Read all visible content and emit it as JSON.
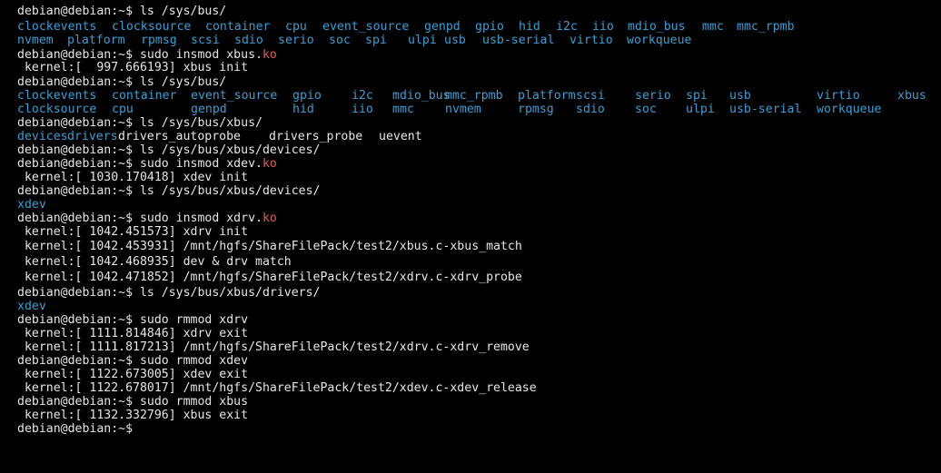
{
  "colors": {
    "background": "#000000",
    "text": "#e6e6e6",
    "directory": "#3a9fd6",
    "ko_ext": "#e05a5a"
  },
  "lines": [
    {
      "segs": [
        {
          "text": "debian@debian:~$ ls /sys/bus/",
          "c": "normal"
        }
      ]
    },
    {
      "segs": [
        {
          "text": "clockevents",
          "c": "blue"
        },
        {
          "text": "clocksource",
          "c": "blue"
        },
        {
          "text": "container",
          "c": "blue"
        },
        {
          "text": "cpu",
          "c": "blue"
        },
        {
          "text": "event_source",
          "c": "blue"
        },
        {
          "text": "genpd",
          "c": "blue"
        },
        {
          "text": "gpio",
          "c": "blue"
        },
        {
          "text": "hid",
          "c": "blue"
        },
        {
          "text": "i2c",
          "c": "blue"
        },
        {
          "text": "iio",
          "c": "blue"
        },
        {
          "text": "mdio_bus",
          "c": "blue"
        },
        {
          "text": "mmc",
          "c": "blue"
        },
        {
          "text": "mmc_rpmb",
          "c": "blue"
        }
      ]
    },
    {
      "segs": [
        {
          "text": "nvmem",
          "c": "blue"
        },
        {
          "text": "platform",
          "c": "blue"
        },
        {
          "text": "rpmsg",
          "c": "blue"
        },
        {
          "text": "scsi",
          "c": "blue"
        },
        {
          "text": "sdio",
          "c": "blue"
        },
        {
          "text": "serio",
          "c": "blue"
        },
        {
          "text": "soc",
          "c": "blue"
        },
        {
          "text": "spi",
          "c": "blue"
        },
        {
          "text": "ulpi",
          "c": "blue"
        },
        {
          "text": "usb",
          "c": "blue"
        },
        {
          "text": "usb-serial",
          "c": "blue"
        },
        {
          "text": "virtio",
          "c": "blue"
        },
        {
          "text": "workqueue",
          "c": "blue"
        }
      ]
    },
    {
      "segs": [
        {
          "text": "debian@debian:~$ sudo insmod xbus.",
          "c": "normal"
        },
        {
          "text": "ko",
          "c": "red"
        }
      ]
    },
    {
      "segs": [
        {
          "text": " kernel:[  997.666193] xbus init",
          "c": "normal"
        }
      ]
    },
    {
      "segs": [
        {
          "text": "debian@debian:~$ ls /sys/bus/",
          "c": "normal"
        }
      ]
    },
    {
      "segs": [
        {
          "text": "clockevents",
          "c": "blue"
        },
        {
          "text": "container",
          "c": "blue"
        },
        {
          "text": "event_source",
          "c": "blue"
        },
        {
          "text": "gpio",
          "c": "blue"
        },
        {
          "text": "i2c",
          "c": "blue"
        },
        {
          "text": "mdio_bus",
          "c": "blue"
        },
        {
          "text": "mmc_rpmb",
          "c": "blue"
        },
        {
          "text": "platform",
          "c": "blue"
        },
        {
          "text": "scsi",
          "c": "blue"
        },
        {
          "text": "serio",
          "c": "blue"
        },
        {
          "text": "spi",
          "c": "blue"
        },
        {
          "text": "usb",
          "c": "blue"
        },
        {
          "text": "virtio",
          "c": "blue"
        },
        {
          "text": "xbus",
          "c": "blue"
        }
      ]
    },
    {
      "segs": [
        {
          "text": "clocksource",
          "c": "blue"
        },
        {
          "text": "cpu",
          "c": "blue"
        },
        {
          "text": "genpd",
          "c": "blue"
        },
        {
          "text": "hid",
          "c": "blue"
        },
        {
          "text": "iio",
          "c": "blue"
        },
        {
          "text": "mmc",
          "c": "blue"
        },
        {
          "text": "nvmem",
          "c": "blue"
        },
        {
          "text": "rpmsg",
          "c": "blue"
        },
        {
          "text": "sdio",
          "c": "blue"
        },
        {
          "text": "soc",
          "c": "blue"
        },
        {
          "text": "ulpi",
          "c": "blue"
        },
        {
          "text": "usb-serial",
          "c": "blue"
        },
        {
          "text": "workqueue",
          "c": "blue"
        }
      ]
    },
    {
      "segs": [
        {
          "text": "debian@debian:~$ ls /sys/bus/xbus/",
          "c": "normal"
        }
      ]
    },
    {
      "segs": [
        {
          "text": "devices",
          "c": "blue"
        },
        {
          "text": "drivers",
          "c": "blue"
        },
        {
          "text": "drivers_autoprobe",
          "c": "normal"
        },
        {
          "text": "drivers_probe",
          "c": "normal"
        },
        {
          "text": "uevent",
          "c": "normal"
        }
      ]
    },
    {
      "segs": [
        {
          "text": "debian@debian:~$ ls /sys/bus/xbus/devices/",
          "c": "normal"
        }
      ]
    },
    {
      "segs": [
        {
          "text": "debian@debian:~$ sudo insmod xdev.",
          "c": "normal"
        },
        {
          "text": "ko",
          "c": "red"
        }
      ]
    },
    {
      "segs": [
        {
          "text": " kernel:[ 1030.170418] xdev init",
          "c": "normal"
        }
      ]
    },
    {
      "segs": [
        {
          "text": "debian@debian:~$ ls /sys/bus/xbus/devices/",
          "c": "normal"
        }
      ]
    },
    {
      "segs": [
        {
          "text": "xdev",
          "c": "blue"
        }
      ]
    },
    {
      "segs": [
        {
          "text": "debian@debian:~$ sudo insmod xdrv.",
          "c": "normal"
        },
        {
          "text": "ko",
          "c": "red"
        }
      ]
    },
    {
      "segs": [
        {
          "text": " kernel:[ 1042.451573] xdrv init",
          "c": "normal"
        }
      ]
    },
    {
      "segs": [
        {
          "text": " kernel:[ 1042.453931] /mnt/hgfs/ShareFilePack/test2/xbus.c-xbus_match",
          "c": "normal"
        }
      ]
    },
    {
      "segs": [
        {
          "text": " kernel:[ 1042.468935] dev & drv match",
          "c": "normal"
        }
      ]
    },
    {
      "segs": [
        {
          "text": " kernel:[ 1042.471852] /mnt/hgfs/ShareFilePack/test2/xdrv.c-xdrv_probe",
          "c": "normal"
        }
      ]
    },
    {
      "segs": [
        {
          "text": "debian@debian:~$ ls /sys/bus/xbus/drivers/",
          "c": "normal"
        }
      ]
    },
    {
      "segs": [
        {
          "text": "xdev",
          "c": "blue"
        }
      ]
    },
    {
      "segs": [
        {
          "text": "debian@debian:~$ sudo rmmod xdrv",
          "c": "normal"
        }
      ]
    },
    {
      "segs": [
        {
          "text": " kernel:[ 1111.814846] xdrv exit",
          "c": "normal"
        }
      ]
    },
    {
      "segs": [
        {
          "text": " kernel:[ 1111.817213] /mnt/hgfs/ShareFilePack/test2/xdrv.c-xdrv_remove",
          "c": "normal"
        }
      ]
    },
    {
      "segs": [
        {
          "text": "debian@debian:~$ sudo rmmod xdev",
          "c": "normal"
        }
      ]
    },
    {
      "segs": [
        {
          "text": " kernel:[ 1122.673005] xdev exit",
          "c": "normal"
        }
      ]
    },
    {
      "segs": [
        {
          "text": " kernel:[ 1122.678017] /mnt/hgfs/ShareFilePack/test2/xdev.c-xdev_release",
          "c": "normal"
        }
      ]
    },
    {
      "segs": [
        {
          "text": "debian@debian:~$ sudo rmmod xbus",
          "c": "normal"
        }
      ]
    },
    {
      "segs": [
        {
          "text": " kernel:[ 1132.332796] xbus exit",
          "c": "normal"
        }
      ]
    },
    {
      "segs": [
        {
          "text": "debian@debian:~$",
          "c": "normal"
        }
      ]
    }
  ]
}
